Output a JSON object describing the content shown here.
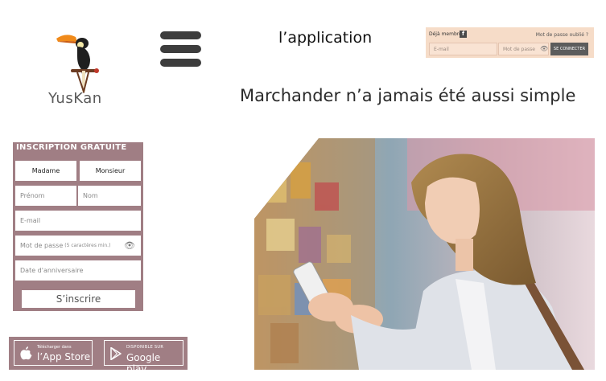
{
  "logo": {
    "text": "YusKan"
  },
  "header": {
    "title": "l’application"
  },
  "login": {
    "member_label": "Déjà membre ?",
    "facebook_icon": "facebook-icon",
    "forgot_label": "Mot de passe oublié ?",
    "email_placeholder": "E-mail",
    "password_placeholder": "Mot de passe",
    "submit_label": "SE CONNECTER"
  },
  "tagline": "Marchander n’a jamais été aussi simple",
  "registration": {
    "title": "INSCRIPTION GRATUITE",
    "gender_options": [
      "Madame",
      "Monsieur"
    ],
    "first_name_placeholder": "Prénom",
    "last_name_placeholder": "Nom",
    "email_placeholder": "E-mail",
    "password_placeholder": "Mot de passe",
    "password_hint": "(5 caractères min.)",
    "birthday_placeholder": "Date d'anniversaire",
    "submit_label": "S’inscrire"
  },
  "stores": {
    "apple_small": "Télécharger dans",
    "apple_large": "l’App Store",
    "google_small": "DISPONIBLE SUR",
    "google_large": "Google play"
  },
  "hero": {
    "image_description_icon": "woman-shopping-photo"
  },
  "colors": {
    "panel": "#a07e84",
    "login_bg": "#f6dcc8",
    "dark": "#3d3d3d"
  }
}
